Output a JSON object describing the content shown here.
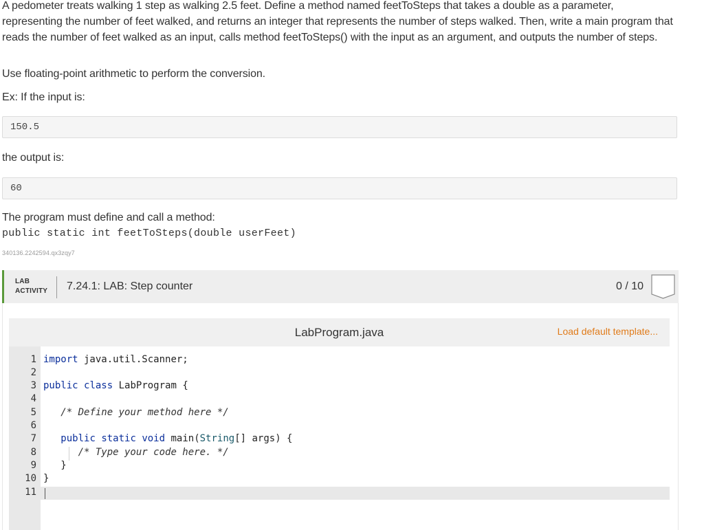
{
  "problem": {
    "intro": "A pedometer treats walking 1 step as walking 2.5 feet. Define a method named feetToSteps that takes a double as a parameter, representing the number of feet walked, and returns an integer that represents the number of steps walked. Then, write a main program that reads the number of feet walked as an input, calls method feetToSteps() with the input as an argument, and outputs the number of steps.",
    "note": "Use floating-point arithmetic to perform the conversion.",
    "example_input_label": "Ex: If the input is:",
    "example_input": "150.5",
    "example_output_label": "the output is:",
    "example_output": "60",
    "method_req": "The program must define and call a method:",
    "signature": "public static int feetToSteps(double userFeet)",
    "content_id": "340136.2242594.qx3zqy7"
  },
  "lab": {
    "tag_line1": "LAB",
    "tag_line2": "ACTIVITY",
    "title": "7.24.1: LAB: Step counter",
    "score": "0 / 10"
  },
  "editor": {
    "filename": "LabProgram.java",
    "load_template": "Load default template...",
    "line_numbers": [
      "1",
      "2",
      "3",
      "4",
      "5",
      "6",
      "7",
      "8",
      "9",
      "10",
      "11"
    ],
    "lines": [
      "import java.util.Scanner;",
      "",
      "public class LabProgram {",
      "",
      "   /* Define your method here */",
      "",
      "   public static void main(String[] args) {",
      "      /* Type your code here. */",
      "   }",
      "}",
      ""
    ]
  },
  "colors": {
    "accent_green": "#5a9a3a",
    "link_orange": "#e07b1a",
    "keyword_blue": "#0b2f9b"
  }
}
